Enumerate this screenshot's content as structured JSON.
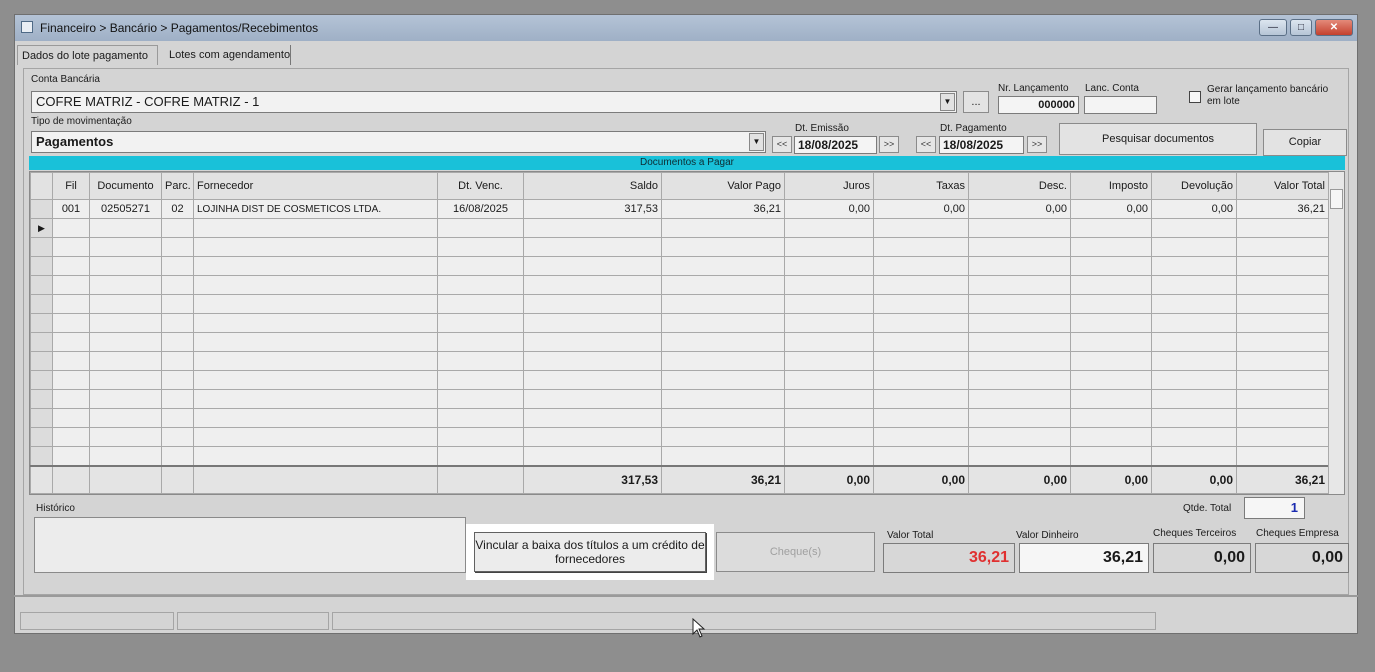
{
  "window": {
    "title": "Financeiro > Bancário > Pagamentos/Recebimentos",
    "controls": {
      "minimize": "—",
      "maximize": "□",
      "close": "✕"
    }
  },
  "tabs": [
    {
      "label": "Dados do lote pagamento"
    },
    {
      "label": "Lotes com agendamento"
    }
  ],
  "form": {
    "conta_label": "Conta Bancária",
    "conta_value": "COFRE MATRIZ - COFRE MATRIZ - 1",
    "browse_label": "...",
    "nr_lanc_label": "Nr. Lançamento",
    "nr_lanc_value": "000000",
    "lanc_conta_label": "Lanc. Conta",
    "lanc_conta_value": "",
    "gerar_label_1": "Gerar lançamento bancário",
    "gerar_label_2": "em lote",
    "tipo_label": "Tipo de movimentação",
    "tipo_value": "Pagamentos",
    "dt_emissao_label": "Dt. Emissão",
    "dt_emissao_value": "18/08/2025",
    "dt_pagamento_label": "Dt. Pagamento",
    "dt_pagamento_value": "18/08/2025",
    "prev": "<<",
    "next": ">>",
    "pesquisar_label": "Pesquisar documentos",
    "copiar_label": "Copiar"
  },
  "grid": {
    "title": "Documentos a Pagar",
    "columns": [
      "Fil",
      "Documento",
      "Parc.",
      "Fornecedor",
      "Dt. Venc.",
      "Saldo",
      "Valor Pago",
      "Juros",
      "Taxas",
      "Desc.",
      "Imposto",
      "Devolução",
      "Valor Total"
    ],
    "rows": [
      {
        "fil": "001",
        "documento": "02505271",
        "parc": "02",
        "fornecedor": "LOJINHA DIST DE COSMETICOS LTDA.",
        "dt_venc": "16/08/2025",
        "saldo": "317,53",
        "valor_pago": "36,21",
        "juros": "0,00",
        "taxas": "0,00",
        "desc": "0,00",
        "imposto": "0,00",
        "devolucao": "0,00",
        "valor_total": "36,21"
      }
    ],
    "current_row_indicator": "▶",
    "totals": {
      "saldo": "317,53",
      "valor_pago": "36,21",
      "juros": "0,00",
      "taxas": "0,00",
      "desc": "0,00",
      "imposto": "0,00",
      "devolucao": "0,00",
      "valor_total": "36,21"
    }
  },
  "footer": {
    "historico_label": "Histórico",
    "qtde_label": "Qtde. Total",
    "qtde_value": "1",
    "vincular_label": "Vincular a baixa dos títulos a um crédito de fornecedores",
    "cheques_btn_label": "Cheque(s)",
    "valor_total_label": "Valor Total",
    "valor_total_value": "36,21",
    "valor_dinheiro_label": "Valor Dinheiro",
    "valor_dinheiro_value": "36,21",
    "cheques_terceiros_label": "Cheques Terceiros",
    "cheques_terceiros_value": "0,00",
    "cheques_empresa_label": "Cheques Empresa",
    "cheques_empresa_value": "0,00"
  },
  "colors": {
    "grid_header": "#19c1d9",
    "valor_total_text": "#e03030",
    "qtde_text": "#1a2bb0"
  }
}
